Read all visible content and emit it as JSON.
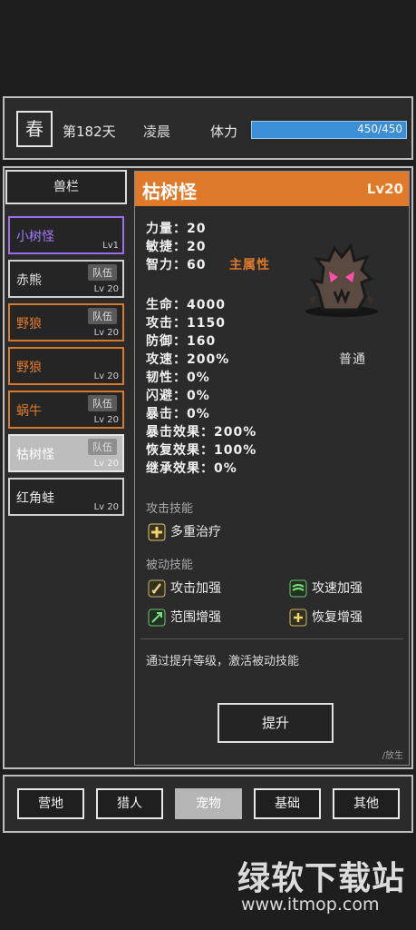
{
  "top": {
    "season": "春",
    "day": "第182天",
    "time": "凌晨",
    "stamina_label": "体力",
    "stamina_value": "450/450",
    "stamina_fraction": 1.0
  },
  "sidebar": {
    "title": "兽栏",
    "pets": [
      {
        "name": "小树怪",
        "level": "Lv1",
        "tag": "",
        "color": "#a67cff"
      },
      {
        "name": "赤熊",
        "level": "Lv 20",
        "tag": "队伍",
        "color": "#ececec"
      },
      {
        "name": "野狼",
        "level": "Lv 20",
        "tag": "队伍",
        "color": "#e07a2b"
      },
      {
        "name": "野狼",
        "level": "Lv 20",
        "tag": "",
        "color": "#e07a2b"
      },
      {
        "name": "蜗牛",
        "level": "Lv 20",
        "tag": "队伍",
        "color": "#e07a2b"
      },
      {
        "name": "枯树怪",
        "level": "Lv 20",
        "tag": "队伍",
        "color": "#e07a2b"
      },
      {
        "name": "红角蛙",
        "level": "Lv 20",
        "tag": "",
        "color": "#ececec"
      }
    ]
  },
  "detail": {
    "name": "枯树怪",
    "level": "Lv20",
    "header_color": "#e07a2b",
    "attrs": [
      {
        "label": "力量：20",
        "extra": ""
      },
      {
        "label": "敏捷：20",
        "extra": ""
      },
      {
        "label": "智力：60",
        "extra": "主属性"
      }
    ],
    "stats": [
      "生命：4000",
      "攻击：1150",
      "防御：160",
      "攻速：200%",
      "韧性：0%",
      "闪避：0%",
      "暴击：0%",
      "暴击效果：200%",
      "恢复效果：100%",
      "继承效果：0%"
    ],
    "attack_type": "普通",
    "attack_skill_title": "攻击技能",
    "attack_skills": [
      "多重治疗"
    ],
    "passive_skill_title": "被动技能",
    "passive_skills": [
      "攻击加强",
      "攻速加强",
      "范围增强",
      "恢复增强"
    ],
    "note": "通过提升等级，激活被动技能",
    "upgrade_label": "提升",
    "release_label": "/放生"
  },
  "nav": {
    "items": [
      "营地",
      "猎人",
      "宠物",
      "基础",
      "其他"
    ],
    "active_index": 2
  },
  "watermark": {
    "line1": "绿软下载站",
    "line2": "www.itmop.com"
  }
}
